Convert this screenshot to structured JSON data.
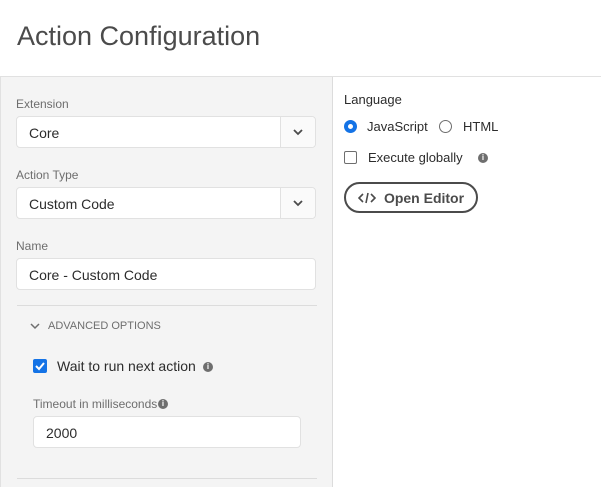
{
  "header": {
    "title": "Action Configuration"
  },
  "extension": {
    "label": "Extension",
    "value": "Core"
  },
  "action_type": {
    "label": "Action Type",
    "value": "Custom Code"
  },
  "name": {
    "label": "Name",
    "value": "Core - Custom Code"
  },
  "advanced": {
    "label": "ADVANCED OPTIONS",
    "wait_label": "Wait to run next action",
    "wait_checked": true,
    "timeout_label": "Timeout in milliseconds",
    "timeout_value": "2000"
  },
  "language": {
    "label": "Language",
    "options": [
      "JavaScript",
      "HTML"
    ],
    "selected": "JavaScript",
    "execute_globally": "Execute globally",
    "open_editor": "Open Editor"
  },
  "colors": {
    "accent": "#1473e6"
  }
}
